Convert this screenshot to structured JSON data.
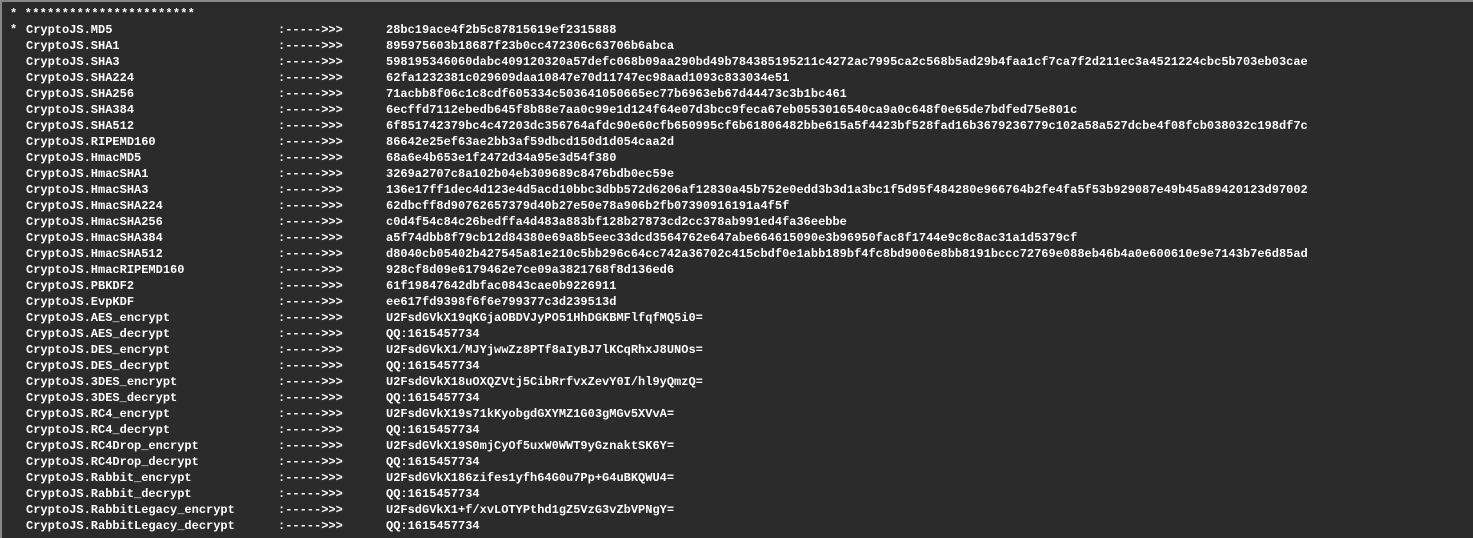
{
  "header": "* ***********************",
  "separator": ":----->>>",
  "lines": [
    {
      "prefix": "* ",
      "name": "CryptoJS.MD5",
      "value": "28bc19ace4f2b5c87815619ef2315888"
    },
    {
      "prefix": "",
      "name": "CryptoJS.SHA1",
      "value": "895975603b18687f23b0cc472306c63706b6abca"
    },
    {
      "prefix": "",
      "name": "CryptoJS.SHA3",
      "value": "598195346060dabc409120320a57defc068b09aa290bd49b784385195211c4272ac7995ca2c568b5ad29b4faa1cf7ca7f2d211ec3a4521224cbc5b703eb03cae"
    },
    {
      "prefix": "",
      "name": "CryptoJS.SHA224",
      "value": "62fa1232381c029609daa10847e70d11747ec98aad1093c833034e51"
    },
    {
      "prefix": "",
      "name": "CryptoJS.SHA256",
      "value": "71acbb8f06c1c8cdf605334c503641050665ec77b6963eb67d44473c3b1bc461"
    },
    {
      "prefix": "",
      "name": "CryptoJS.SHA384",
      "value": "6ecffd7112ebedb645f8b88e7aa0c99e1d124f64e07d3bcc9feca67eb0553016540ca9a0c648f0e65de7bdfed75e801c"
    },
    {
      "prefix": "",
      "name": "CryptoJS.SHA512",
      "value": "6f851742379bc4c47203dc356764afdc90e60cfb650995cf6b61806482bbe615a5f4423bf528fad16b3679236779c102a58a527dcbe4f08fcb038032c198df7c"
    },
    {
      "prefix": "",
      "name": "CryptoJS.RIPEMD160",
      "value": "86642e25ef63ae2bb3af59dbcd150d1d054caa2d"
    },
    {
      "prefix": "",
      "name": "CryptoJS.HmacMD5",
      "value": "68a6e4b653e1f2472d34a95e3d54f380"
    },
    {
      "prefix": "",
      "name": "CryptoJS.HmacSHA1",
      "value": "3269a2707c8a102b04eb309689c8476bdb0ec59e"
    },
    {
      "prefix": "",
      "name": "CryptoJS.HmacSHA3",
      "value": "136e17ff1dec4d123e4d5acd10bbc3dbb572d6206af12830a45b752e0edd3b3d1a3bc1f5d95f484280e966764b2fe4fa5f53b929087e49b45a89420123d97002"
    },
    {
      "prefix": "",
      "name": "CryptoJS.HmacSHA224",
      "value": "62dbcff8d90762657379d40b27e50e78a906b2fb07390916191a4f5f"
    },
    {
      "prefix": "",
      "name": "CryptoJS.HmacSHA256",
      "value": "c0d4f54c84c26bedffa4d483a883bf128b27873cd2cc378ab991ed4fa36eebbe"
    },
    {
      "prefix": "",
      "name": "CryptoJS.HmacSHA384",
      "value": "a5f74dbb8f79cb12d84380e69a8b5eec33dcd3564762e647abe664615090e3b96950fac8f1744e9c8c8ac31a1d5379cf"
    },
    {
      "prefix": "",
      "name": "CryptoJS.HmacSHA512",
      "value": "d8040cb05402b427545a81e210c5bb296c64cc742a36702c415cbdf0e1abb189bf4fc8bd9006e8bb8191bccc72769e088eb46b4a0e600610e9e7143b7e6d85ad"
    },
    {
      "prefix": "",
      "name": "CryptoJS.HmacRIPEMD160",
      "value": "928cf8d09e6179462e7ce09a3821768f8d136ed6"
    },
    {
      "prefix": "",
      "name": "CryptoJS.PBKDF2",
      "value": "61f19847642dbfac0843cae0b9226911"
    },
    {
      "prefix": "",
      "name": "CryptoJS.EvpKDF",
      "value": "ee617fd9398f6f6e799377c3d239513d"
    },
    {
      "prefix": "",
      "name": "CryptoJS.AES_encrypt",
      "value": "U2FsdGVkX19qKGjaOBDVJyPO51HhDGKBMFlfqfMQ5i0="
    },
    {
      "prefix": "",
      "name": "CryptoJS.AES_decrypt",
      "value": "QQ:1615457734"
    },
    {
      "prefix": "",
      "name": "CryptoJS.DES_encrypt",
      "value": "U2FsdGVkX1/MJYjwwZz8PTf8aIyBJ7lKCqRhxJ8UNOs="
    },
    {
      "prefix": "",
      "name": "CryptoJS.DES_decrypt",
      "value": "QQ:1615457734"
    },
    {
      "prefix": "",
      "name": "CryptoJS.3DES_encrypt",
      "value": "U2FsdGVkX18uOXQZVtj5CibRrfvxZevY0I/hl9yQmzQ="
    },
    {
      "prefix": "",
      "name": "CryptoJS.3DES_decrypt",
      "value": "QQ:1615457734"
    },
    {
      "prefix": "",
      "name": "CryptoJS.RC4_encrypt",
      "value": "U2FsdGVkX19s71kKyobgdGXYMZ1G03gMGv5XVvA="
    },
    {
      "prefix": "",
      "name": "CryptoJS.RC4_decrypt",
      "value": "QQ:1615457734"
    },
    {
      "prefix": "",
      "name": "CryptoJS.RC4Drop_encrypt",
      "value": "U2FsdGVkX19S0mjCyOf5uxW0WWT9yGznaktSK6Y="
    },
    {
      "prefix": "",
      "name": "CryptoJS.RC4Drop_decrypt",
      "value": "QQ:1615457734"
    },
    {
      "prefix": "",
      "name": "CryptoJS.Rabbit_encrypt",
      "value": "U2FsdGVkX186zifes1yfh64G0u7Pp+G4uBKQWU4="
    },
    {
      "prefix": "",
      "name": "CryptoJS.Rabbit_decrypt",
      "value": "QQ:1615457734"
    },
    {
      "prefix": "",
      "name": "CryptoJS.RabbitLegacy_encrypt",
      "value": "U2FsdGVkX1+f/xvLOTYPthd1gZ5VzG3vZbVPNgY="
    },
    {
      "prefix": "",
      "name": "CryptoJS.RabbitLegacy_decrypt",
      "value": "QQ:1615457734"
    }
  ]
}
